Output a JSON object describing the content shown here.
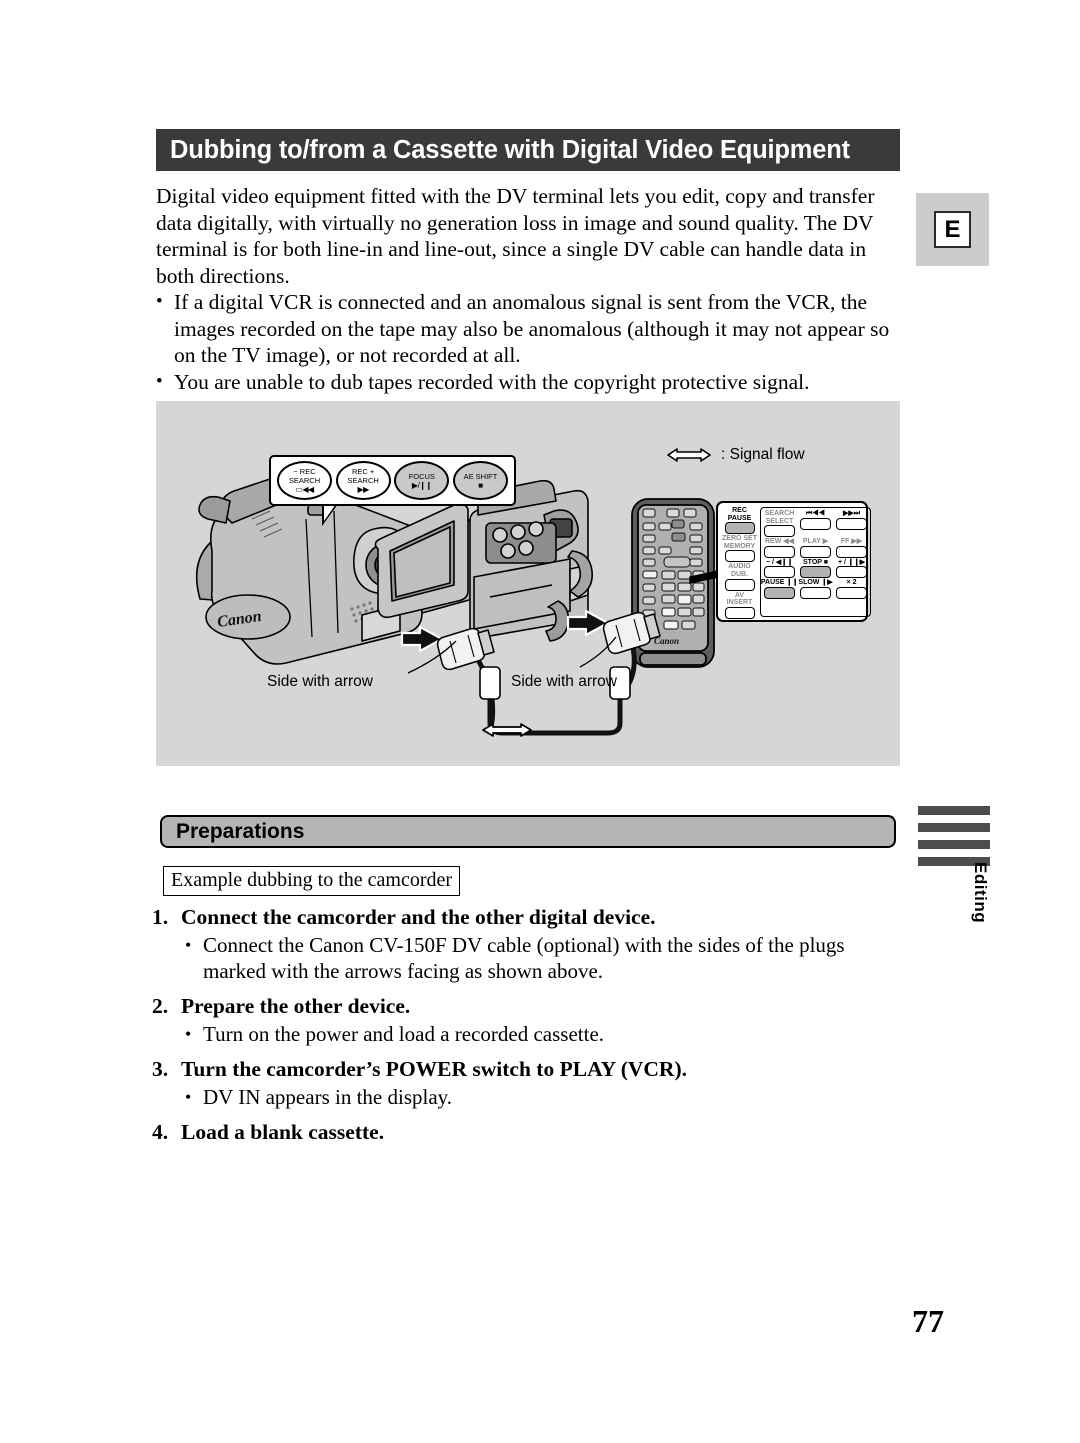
{
  "page": {
    "title": "Dubbing to/from a Cassette with Digital Video Equipment",
    "language_marker": "E",
    "page_number": "77",
    "edge_tab_label": "Editing"
  },
  "intro": {
    "paragraph": "Digital video equipment fitted with the DV terminal lets you edit, copy and transfer data digitally, with virtually no generation loss in image and sound quality. The DV terminal is for both line-in and line-out, since a single DV cable can handle data in both directions."
  },
  "notes": {
    "bullet_char": "•",
    "items": [
      "If a digital VCR is connected and an anomalous signal is sent from the VCR, the images recorded on the tape may also be anomalous (although it may not appear so on the TV image), or not recorded at all.",
      "You are unable to dub tapes recorded with the copyright protective signal."
    ]
  },
  "figure": {
    "legend_text": ": Signal flow",
    "camcorder_buttons": [
      {
        "line1": "− REC",
        "line2": "SEARCH",
        "glyph": "▭◀◀",
        "shaded": false
      },
      {
        "line1": "REC +",
        "line2": "SEARCH",
        "glyph": "▶▶",
        "shaded": false
      },
      {
        "line1": "FOCUS",
        "line2": "",
        "glyph": "▶/❙❙",
        "shaded": true
      },
      {
        "line1": "AE SHIFT",
        "line2": "",
        "glyph": "■",
        "shaded": true
      }
    ],
    "remote_panel": {
      "left_column": [
        {
          "label": "REC\nPAUSE",
          "label_line1": "REC",
          "label_line2": "PAUSE",
          "highlighted": true,
          "dim": false
        },
        {
          "label_line1": "ZERO SET",
          "label_line2": "MEMORY",
          "highlighted": false,
          "dim": true
        },
        {
          "label_line1": "AUDIO",
          "label_line2": "DUB.",
          "highlighted": false,
          "dim": true
        },
        {
          "label_line1": "AV",
          "label_line2": "INSERT",
          "highlighted": false,
          "dim": true
        }
      ],
      "right_grid": [
        [
          {
            "label_line1": "SEARCH",
            "label_line2": "SELECT",
            "highlighted": false,
            "dim": true
          },
          {
            "label_line1": "⏮◀◀",
            "label_line2": "",
            "highlighted": false,
            "dim": false
          },
          {
            "label_line1": "▶▶⏭",
            "label_line2": "",
            "highlighted": false,
            "dim": false
          }
        ],
        [
          {
            "label_line1": "REW ◀◀",
            "label_line2": "",
            "highlighted": false,
            "dim": true
          },
          {
            "label_line1": "PLAY ▶",
            "label_line2": "",
            "highlighted": false,
            "dim": true
          },
          {
            "label_line1": "FF ▶▶",
            "label_line2": "",
            "highlighted": false,
            "dim": true
          }
        ],
        [
          {
            "label_line1": "− / ◀❙❙",
            "label_line2": "",
            "highlighted": false,
            "dim": false
          },
          {
            "label_line1": "STOP ■",
            "label_line2": "",
            "highlighted": true,
            "dim": false
          },
          {
            "label_line1": "+ / ❙❙▶",
            "label_line2": "",
            "highlighted": false,
            "dim": false
          }
        ],
        [
          {
            "label_line1": "PAUSE ❙❙",
            "label_line2": "",
            "highlighted": true,
            "dim": false
          },
          {
            "label_line1": "SLOW ❙▶",
            "label_line2": "",
            "highlighted": false,
            "dim": false
          },
          {
            "label_line1": "× 2",
            "label_line2": "",
            "highlighted": false,
            "dim": false
          }
        ]
      ]
    },
    "cable_labels": [
      "Side with arrow",
      "Side with arrow"
    ],
    "brand_camcorder": "Canon",
    "brand_remote": "Canon"
  },
  "preparations": {
    "heading": "Preparations",
    "example_label": "Example dubbing to the camcorder",
    "bullet_char": "•",
    "steps": [
      {
        "number": "1.",
        "title": "Connect the camcorder and the other digital device.",
        "bullets": [
          "Connect the Canon CV-150F DV cable (optional) with the sides of the plugs marked with the arrows facing as shown above."
        ]
      },
      {
        "number": "2.",
        "title": "Prepare the other device.",
        "bullets": [
          "Turn on the power and load a recorded cassette."
        ]
      },
      {
        "number": "3.",
        "title": "Turn the camcorder’s POWER switch to PLAY (VCR).",
        "bullets": [
          "DV IN appears in the display."
        ]
      },
      {
        "number": "4.",
        "title": "Load a blank cassette.",
        "bullets": []
      }
    ]
  },
  "colors": {
    "title_bar_bg": "#3a3a3a",
    "title_bar_fg": "#ffffff",
    "figure_bg": "#d6d6d6",
    "band_bg": "#b5b5b5",
    "edge_tab": "#4d4d4d",
    "key_highlight": "#b3b3b3"
  }
}
